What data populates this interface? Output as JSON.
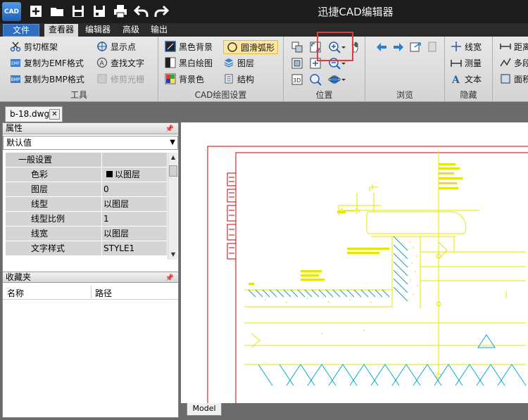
{
  "app": {
    "logo_text": "CAD",
    "window_title": "迅捷CAD编辑器"
  },
  "menu": {
    "file": "文件",
    "viewer": "查看器",
    "editor": "编辑器",
    "advanced": "高级",
    "output": "输出"
  },
  "ribbon": {
    "tools": {
      "label": "工具",
      "clip_frame": "剪切框架",
      "copy_emf": "复制为EMF格式",
      "copy_bmp": "复制为BMP格式",
      "show_points": "显示点",
      "find_text": "查找文字",
      "trim_raster": "修剪光栅"
    },
    "cad_settings": {
      "label": "CAD绘图设置",
      "black_bg": "黑色背景",
      "bw_drawing": "黑白绘图",
      "bg_color": "背景色",
      "smooth_arc": "圆滑弧形",
      "layers": "图层",
      "structure": "结构"
    },
    "position": {
      "label": "位置"
    },
    "browse": {
      "label": "浏览"
    },
    "hide": {
      "label": "隐藏",
      "linewidth": "线宽",
      "measure": "测量",
      "text": "文本"
    },
    "cut_right": {
      "distance": "距离",
      "multi": "多段",
      "area": "面积"
    }
  },
  "document": {
    "tab": "b-18.dwg",
    "model_tab": "Model"
  },
  "properties": {
    "title": "属性",
    "selector": "默认值",
    "category": "一般设置",
    "rows": [
      {
        "name": "色彩",
        "value": "以图层"
      },
      {
        "name": "图层",
        "value": "0"
      },
      {
        "name": "线型",
        "value": "以图层"
      },
      {
        "name": "线型比例",
        "value": "1"
      },
      {
        "name": "线宽",
        "value": "以图层"
      },
      {
        "name": "文字样式",
        "value": "STYLE1"
      }
    ]
  },
  "favorites": {
    "title": "收藏夹",
    "col_name": "名称",
    "col_path": "路径"
  },
  "colors": {
    "accent": "#2f6ec0",
    "highlight": "#e23b3b",
    "cad_yellow": "#e6e600",
    "cad_cyan": "#00aacc",
    "cad_red": "#cc0000"
  }
}
